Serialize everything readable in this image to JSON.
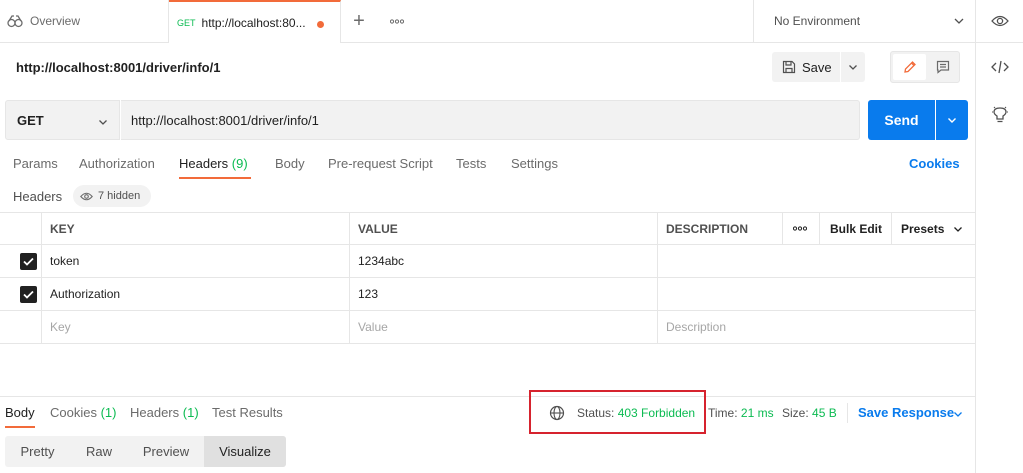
{
  "tabs": {
    "overview_label": "Overview",
    "active_method": "GET",
    "active_title": "http://localhost:80...",
    "plus_glyph": "+",
    "more_glyph": "ooo"
  },
  "environment": {
    "selected": "No Environment"
  },
  "request": {
    "title": "http://localhost:8001/driver/info/1",
    "save_label": "Save",
    "method": "GET",
    "url": "http://localhost:8001/driver/info/1",
    "send_label": "Send"
  },
  "request_tabs": {
    "params": "Params",
    "authorization": "Authorization",
    "headers": "Headers",
    "headers_count": "(9)",
    "body": "Body",
    "prerequest": "Pre-request Script",
    "tests": "Tests",
    "settings": "Settings",
    "cookies": "Cookies"
  },
  "headers_section": {
    "label": "Headers",
    "hidden_text": "7 hidden"
  },
  "headers_table": {
    "col_key": "KEY",
    "col_value": "VALUE",
    "col_description": "DESCRIPTION",
    "more": "ooo",
    "bulk_edit": "Bulk Edit",
    "presets": "Presets",
    "rows": [
      {
        "checked": true,
        "key": "token",
        "value": "1234abc",
        "description": ""
      },
      {
        "checked": true,
        "key": "Authorization",
        "value": "123",
        "description": ""
      }
    ],
    "placeholder": {
      "key": "Key",
      "value": "Value",
      "description": "Description"
    }
  },
  "response": {
    "tabs": {
      "body": "Body",
      "cookies": "Cookies",
      "cookies_count": "(1)",
      "headers": "Headers",
      "headers_count": "(1)",
      "test_results": "Test Results"
    },
    "status_label": "Status:",
    "status_value": "403 Forbidden",
    "time_label": "Time:",
    "time_value": "21 ms",
    "size_label": "Size:",
    "size_value": "45 B",
    "save_response": "Save Response",
    "views": [
      "Pretty",
      "Raw",
      "Preview",
      "Visualize"
    ],
    "active_view": "Visualize"
  },
  "colors": {
    "accent_orange": "#f26b3a",
    "send_blue": "#097bed",
    "success_green": "#0cbb52",
    "highlight_red": "#d6232e"
  }
}
